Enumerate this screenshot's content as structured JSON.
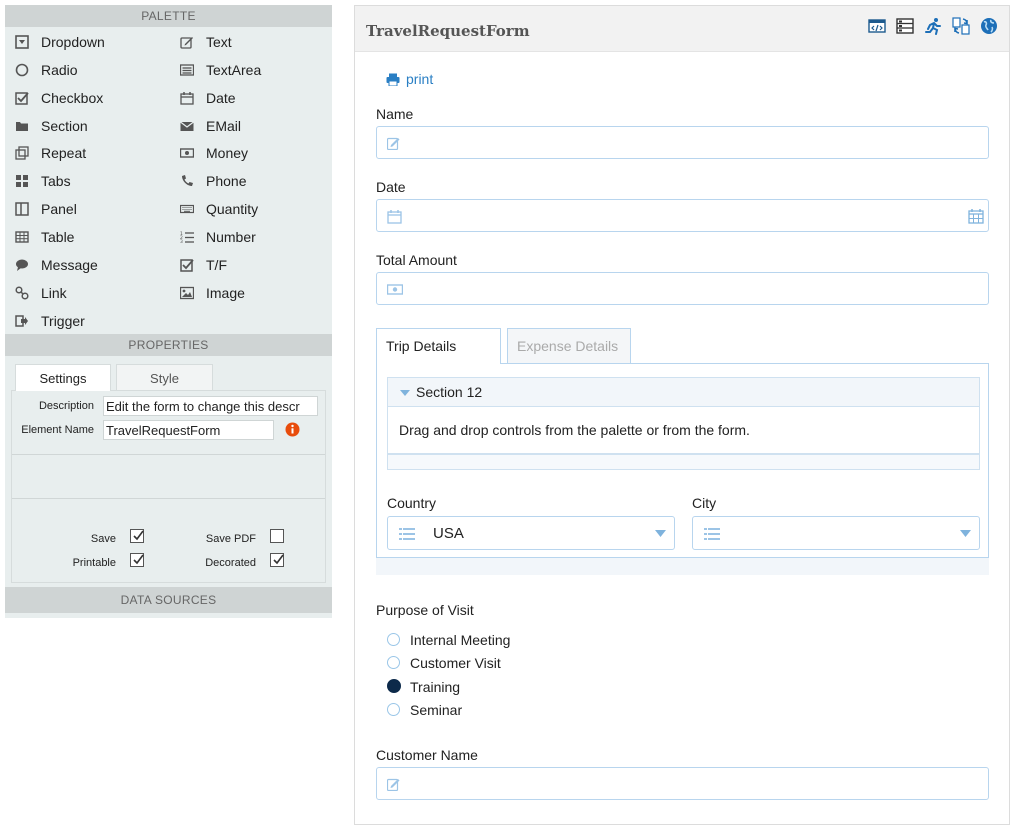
{
  "palette": {
    "title": "PALETTE",
    "items_left": [
      {
        "label": "Dropdown",
        "icon": "dropdown-icon"
      },
      {
        "label": "Radio",
        "icon": "radio-icon"
      },
      {
        "label": "Checkbox",
        "icon": "checkbox-icon"
      },
      {
        "label": "Section",
        "icon": "folder-icon"
      },
      {
        "label": "Repeat",
        "icon": "repeat-icon"
      },
      {
        "label": "Tabs",
        "icon": "tabs-icon"
      },
      {
        "label": "Panel",
        "icon": "panel-icon"
      },
      {
        "label": "Table",
        "icon": "table-icon"
      },
      {
        "label": "Message",
        "icon": "speech-bubble-icon"
      },
      {
        "label": "Link",
        "icon": "link-icon"
      },
      {
        "label": "Trigger",
        "icon": "trigger-icon"
      }
    ],
    "items_right": [
      {
        "label": "Text",
        "icon": "pencil-icon"
      },
      {
        "label": "TextArea",
        "icon": "textarea-icon"
      },
      {
        "label": "Date",
        "icon": "calendar-icon"
      },
      {
        "label": "EMail",
        "icon": "envelope-icon"
      },
      {
        "label": "Money",
        "icon": "money-icon"
      },
      {
        "label": "Phone",
        "icon": "phone-icon"
      },
      {
        "label": "Quantity",
        "icon": "keyboard-icon"
      },
      {
        "label": "Number",
        "icon": "numbered-list-icon"
      },
      {
        "label": "T/F",
        "icon": "checkbox-icon"
      },
      {
        "label": "Image",
        "icon": "image-icon"
      }
    ]
  },
  "properties": {
    "title": "PROPERTIES",
    "tabs": [
      "Settings",
      "Style"
    ],
    "description_label": "Description",
    "description_value": "Edit the form to change this descr",
    "element_name_label": "Element Name",
    "element_name_value": "TravelRequestForm",
    "checks": [
      {
        "label": "Save",
        "checked": true
      },
      {
        "label": "Save PDF",
        "checked": false
      },
      {
        "label": "Printable",
        "checked": true
      },
      {
        "label": "Decorated",
        "checked": true
      }
    ]
  },
  "data_sources": {
    "title": "DATA SOURCES"
  },
  "form": {
    "title": "TravelRequestForm",
    "toolbar_icons": [
      "code-icon",
      "list-icon",
      "run-icon",
      "refresh-icon",
      "globe-icon"
    ],
    "print_label": "print",
    "name_label": "Name",
    "date_label": "Date",
    "total_amount_label": "Total Amount",
    "tabs": [
      "Trip Details",
      "Expense Details"
    ],
    "section_title": "Section 12",
    "section_message": "Drag and drop controls from the palette or from the form.",
    "country_label": "Country",
    "country_value": "USA",
    "city_label": "City",
    "city_value": "",
    "purpose_label": "Purpose of Visit",
    "purpose_options": [
      "Internal Meeting",
      "Customer Visit",
      "Training",
      "Seminar"
    ],
    "purpose_selected": "Training",
    "customer_name_label": "Customer Name"
  },
  "colors": {
    "accent": "#2a7fc4",
    "field_border": "#b8d5ee",
    "selected_radio": "#0d2a4a",
    "info_icon": "#e84c0c"
  }
}
